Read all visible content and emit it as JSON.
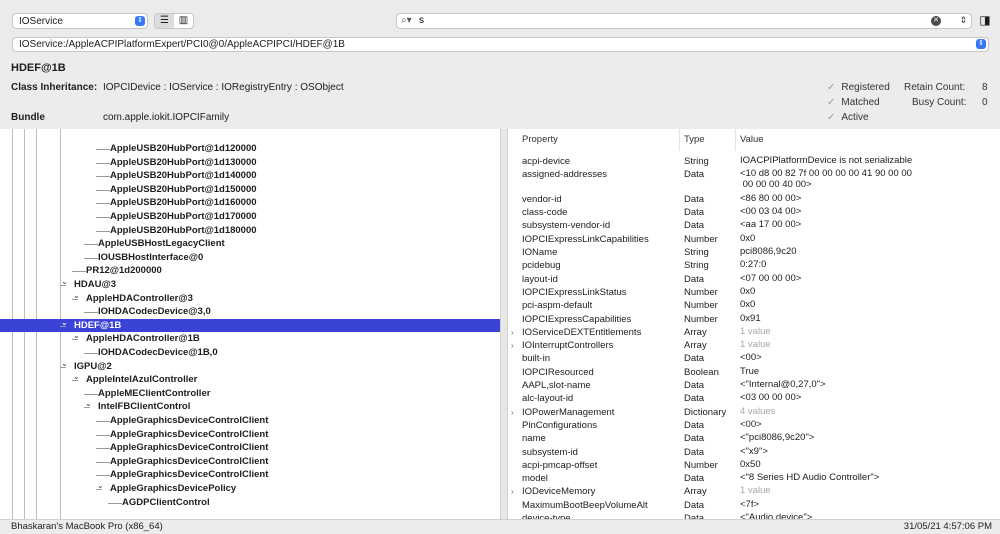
{
  "toolbar": {
    "plane": "IOService",
    "view_list_icon": "list-icon",
    "view_columns_icon": "columns-icon",
    "search_value": "s",
    "inspector_icon": "sidebar-icon"
  },
  "path": "IOService:/AppleACPIPlatformExpert/PCI0@0/AppleACPIPCI/HDEF@1B",
  "info": {
    "name": "HDEF@1B",
    "class_label": "Class Inheritance:",
    "class_value": "IOPCIDevice : IOService : IORegistryEntry : OSObject",
    "bundle_label": "Bundle",
    "bundle_value": "com.apple.iokit.IOPCIFamily",
    "flags": [
      "Registered",
      "Matched",
      "Active"
    ],
    "retain_label": "Retain Count:",
    "retain_value": "8",
    "busy_label": "Busy Count:",
    "busy_value": "0"
  },
  "tree": [
    {
      "label": "AppleUSB20HubPort@1d120000",
      "depth": 5,
      "expander": ""
    },
    {
      "label": "AppleUSB20HubPort@1d130000",
      "depth": 5,
      "expander": ""
    },
    {
      "label": "AppleUSB20HubPort@1d140000",
      "depth": 5,
      "expander": ""
    },
    {
      "label": "AppleUSB20HubPort@1d150000",
      "depth": 5,
      "expander": ""
    },
    {
      "label": "AppleUSB20HubPort@1d160000",
      "depth": 5,
      "expander": ""
    },
    {
      "label": "AppleUSB20HubPort@1d170000",
      "depth": 5,
      "expander": ""
    },
    {
      "label": "AppleUSB20HubPort@1d180000",
      "depth": 5,
      "expander": ""
    },
    {
      "label": "AppleUSBHostLegacyClient",
      "depth": 4,
      "expander": ""
    },
    {
      "label": "IOUSBHostInterface@0",
      "depth": 4,
      "expander": ""
    },
    {
      "label": "PR12@1d200000",
      "depth": 3,
      "expander": ""
    },
    {
      "label": "HDAU@3",
      "depth": 2,
      "expander": "v"
    },
    {
      "label": "AppleHDAController@3",
      "depth": 3,
      "expander": "v"
    },
    {
      "label": "IOHDACodecDevice@3,0",
      "depth": 4,
      "expander": ""
    },
    {
      "label": "HDEF@1B",
      "depth": 2,
      "expander": "v",
      "selected": true
    },
    {
      "label": "AppleHDAController@1B",
      "depth": 3,
      "expander": "v"
    },
    {
      "label": "IOHDACodecDevice@1B,0",
      "depth": 4,
      "expander": ""
    },
    {
      "label": "IGPU@2",
      "depth": 2,
      "expander": "v"
    },
    {
      "label": "AppleIntelAzulController",
      "depth": 3,
      "expander": "v"
    },
    {
      "label": "AppleMEClientController",
      "depth": 4,
      "expander": ""
    },
    {
      "label": "IntelFBClientControl",
      "depth": 4,
      "expander": "v"
    },
    {
      "label": "AppleGraphicsDeviceControlClient",
      "depth": 5,
      "expander": ""
    },
    {
      "label": "AppleGraphicsDeviceControlClient",
      "depth": 5,
      "expander": ""
    },
    {
      "label": "AppleGraphicsDeviceControlClient",
      "depth": 5,
      "expander": ""
    },
    {
      "label": "AppleGraphicsDeviceControlClient",
      "depth": 5,
      "expander": ""
    },
    {
      "label": "AppleGraphicsDeviceControlClient",
      "depth": 5,
      "expander": ""
    },
    {
      "label": "AppleGraphicsDevicePolicy",
      "depth": 5,
      "expander": "v"
    },
    {
      "label": "AGDPClientControl",
      "depth": 6,
      "expander": ""
    }
  ],
  "props": {
    "headers": [
      "Property",
      "Type",
      "Value"
    ],
    "rows": [
      {
        "name": "acpi-device",
        "type": "String",
        "value": "IOACPIPlatformDevice is not serializable",
        "lines": 1
      },
      {
        "name": "assigned-addresses",
        "type": "Data",
        "value": "<10 d8 00 82 7f 00 00 00 00 41 90 00 00\n 00 00 00 40 00>",
        "lines": 2
      },
      {
        "name": "vendor-id",
        "type": "Data",
        "value": "<86 80 00 00>",
        "lines": 1
      },
      {
        "name": "class-code",
        "type": "Data",
        "value": "<00 03 04 00>",
        "lines": 1
      },
      {
        "name": "subsystem-vendor-id",
        "type": "Data",
        "value": "<aa 17 00 00>",
        "lines": 1
      },
      {
        "name": "IOPCIExpressLinkCapabilities",
        "type": "Number",
        "value": "0x0",
        "lines": 1
      },
      {
        "name": "IOName",
        "type": "String",
        "value": "pci8086,9c20",
        "lines": 1
      },
      {
        "name": "pcidebug",
        "type": "String",
        "value": "0:27:0",
        "lines": 1
      },
      {
        "name": "layout-id",
        "type": "Data",
        "value": "<07 00 00 00>",
        "lines": 1
      },
      {
        "name": "IOPCIExpressLinkStatus",
        "type": "Number",
        "value": "0x0",
        "lines": 1
      },
      {
        "name": "pci-aspm-default",
        "type": "Number",
        "value": "0x0",
        "lines": 1
      },
      {
        "name": "IOPCIExpressCapabilities",
        "type": "Number",
        "value": "0x91",
        "lines": 1
      },
      {
        "name": "IOServiceDEXTEntitlements",
        "type": "Array",
        "value": "1 value",
        "lines": 1,
        "expander": ">",
        "muted": true
      },
      {
        "name": "IOInterruptControllers",
        "type": "Array",
        "value": "1 value",
        "lines": 1,
        "expander": ">",
        "muted": true
      },
      {
        "name": "built-in",
        "type": "Data",
        "value": "<00>",
        "lines": 1
      },
      {
        "name": "IOPCIResourced",
        "type": "Boolean",
        "value": "True",
        "lines": 1
      },
      {
        "name": "AAPL,slot-name",
        "type": "Data",
        "value": "<\"Internal@0,27,0\">",
        "lines": 1
      },
      {
        "name": "alc-layout-id",
        "type": "Data",
        "value": "<03 00 00 00>",
        "lines": 1
      },
      {
        "name": "IOPowerManagement",
        "type": "Dictionary",
        "value": "4 values",
        "lines": 1,
        "expander": ">",
        "muted": true
      },
      {
        "name": "PinConfigurations",
        "type": "Data",
        "value": "<00>",
        "lines": 1
      },
      {
        "name": "name",
        "type": "Data",
        "value": "<\"pci8086,9c20\">",
        "lines": 1
      },
      {
        "name": "subsystem-id",
        "type": "Data",
        "value": "<\"x9\">",
        "lines": 1
      },
      {
        "name": "acpi-pmcap-offset",
        "type": "Number",
        "value": "0x50",
        "lines": 1
      },
      {
        "name": "model",
        "type": "Data",
        "value": "<\"8 Series HD Audio Controller\">",
        "lines": 1
      },
      {
        "name": "IODeviceMemory",
        "type": "Array",
        "value": "1 value",
        "lines": 1,
        "expander": ">",
        "muted": true
      },
      {
        "name": "MaximumBootBeepVolumeAlt",
        "type": "Data",
        "value": "<7f>",
        "lines": 1
      },
      {
        "name": "device-type",
        "type": "Data",
        "value": "<\"Audio device\">",
        "lines": 1
      }
    ]
  },
  "status": {
    "left": "Bhaskaran's MacBook Pro (x86_64)",
    "right": "31/05/21 4:57:06 PM"
  },
  "colors": {
    "selection": "#3b43d6",
    "accent": "#3478f6"
  }
}
